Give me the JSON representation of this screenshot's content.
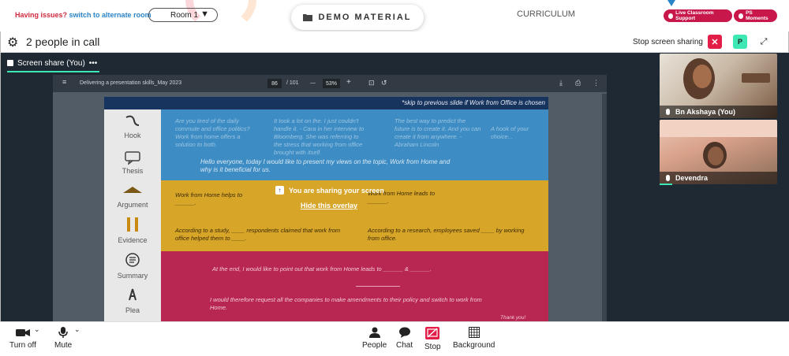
{
  "topbar": {
    "issues_text": "Having issues?",
    "switch_link": "switch to alternate room",
    "room_value": "Room 1",
    "demo_label": "DEMO MATERIAL",
    "curriculum_label": "CURRICULUM",
    "support_label": "Live Classroom Support",
    "moments_label": "PS Moments",
    "accent": "#c8174b"
  },
  "call": {
    "people_count": "2 people in call",
    "stop_share_label": "Stop screen sharing",
    "profile_initial": "P"
  },
  "share": {
    "tab_label": "Screen share (You)",
    "tab_menu": "•••"
  },
  "pdf": {
    "title": "Delivering a presentation skills_May 2023",
    "page": "86",
    "pages": "/ 101",
    "zoom": "53%",
    "zoom_minus": "—",
    "zoom_plus": "+"
  },
  "slide": {
    "top_note": "*skip to previous slide if Work from Office is chosen",
    "labels": [
      "Hook",
      "Thesis",
      "Argument",
      "Evidence",
      "Summary",
      "Plea"
    ],
    "blue_q1": "Are you tired of the daily commute and office politics? Work from home offers a solution to both.",
    "blue_q2": "It took a lot on the. I just couldn't handle it. - Cara in her interview to Bloomberg. She was referring to the stress that working from office brought with itself.",
    "blue_q3": "The best way to predict the future is to create it. And you can create it from anywhere. - Abraham Lincoln",
    "blue_q4": "A hook of your choice...",
    "blue_intro": "Hello everyone, today I would like to present my views on the topic, Work from Home and why is it beneficial for us.",
    "yellow_a1": "Work from Home helps to ______.",
    "yellow_a2": "Work from Home leads to ______.",
    "yellow_e1": "According to a study, ____ respondents claimed that work from office helped them to ____.",
    "yellow_e2": "According to a research, employees saved ____ by working from office.",
    "pink_summary": "At the end, I would like to point out that work from Home leads to ______ & ______.",
    "pink_plea": "I would therefore request all the companies to make amendments to their policy and switch to work from Home.",
    "pink_footer": "Thank you!"
  },
  "overlay": {
    "message": "You are sharing your screen",
    "hide_link": "Hide this overlay"
  },
  "participants": [
    {
      "name": "Bn Akshaya (You)"
    },
    {
      "name": "Devendra"
    }
  ],
  "toolbar": {
    "turn_off": "Turn off",
    "mute": "Mute",
    "people": "People",
    "chat": "Chat",
    "stop": "Stop",
    "background": "Background",
    "stop_color": "#e11d48"
  }
}
